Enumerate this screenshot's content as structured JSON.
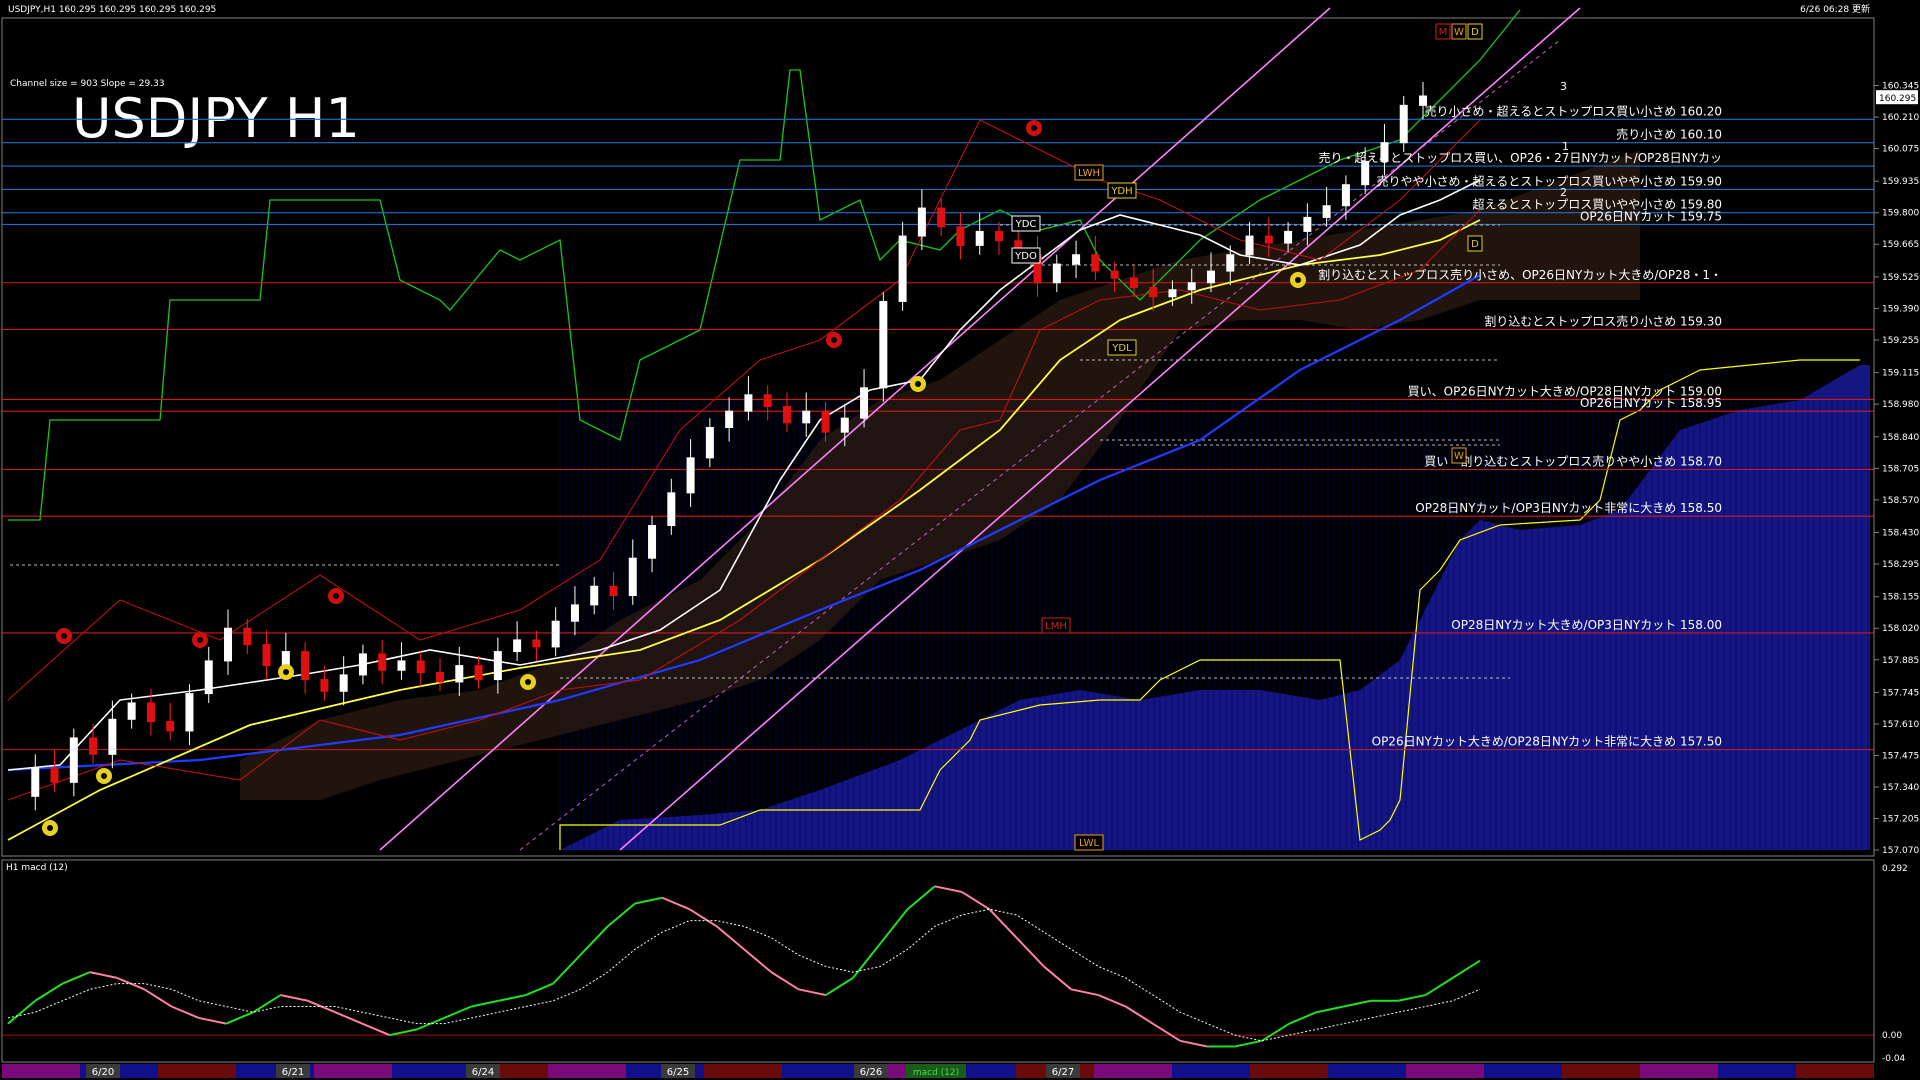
{
  "header": {
    "symbol_info": "USDJPY,H1  160.295 160.295 160.295 160.295",
    "updated": "6/26 06:28 更新",
    "channel_info": "Channel size = 903 Slope = 29.33",
    "big_title": "USDJPY H1",
    "macd_label": "H1  macd (12)"
  },
  "chart_data": {
    "type": "line",
    "title": "USDJPY H1",
    "xlabel": "",
    "ylabel": "",
    "ylim": [
      157.07,
      160.48
    ],
    "price_ticks": [
      "160.345",
      "160.210",
      "160.075",
      "159.935",
      "159.800",
      "159.665",
      "159.525",
      "159.390",
      "159.255",
      "159.115",
      "158.980",
      "158.840",
      "158.705",
      "158.570",
      "158.430",
      "158.295",
      "158.155",
      "158.020",
      "157.885",
      "157.745",
      "157.610",
      "157.475",
      "157.340",
      "157.205",
      "157.070"
    ],
    "current_price": "160.295",
    "price_path": [
      157.3,
      157.42,
      157.36,
      157.55,
      157.48,
      157.63,
      157.7,
      157.62,
      157.58,
      157.74,
      157.88,
      158.02,
      157.95,
      157.86,
      157.92,
      157.8,
      157.75,
      157.82,
      157.91,
      157.84,
      157.88,
      157.83,
      157.79,
      157.86,
      157.8,
      157.92,
      157.97,
      157.94,
      158.05,
      158.12,
      158.2,
      158.16,
      158.32,
      158.46,
      158.6,
      158.75,
      158.88,
      158.95,
      159.02,
      158.97,
      158.9,
      158.95,
      158.86,
      158.92,
      159.05,
      159.42,
      159.7,
      159.82,
      159.74,
      159.66,
      159.72,
      159.68,
      159.62,
      159.5,
      159.58,
      159.62,
      159.55,
      159.52,
      159.48,
      159.44,
      159.47,
      159.5,
      159.55,
      159.62,
      159.7,
      159.67,
      159.72,
      159.78,
      159.83,
      159.92,
      160.02,
      160.1,
      160.26,
      160.3
    ],
    "macd_ylim": [
      -0.04,
      0.292
    ],
    "macd_ticks": [
      "0.292",
      "0.00",
      "-0.04"
    ],
    "macd_main": [
      0.02,
      0.06,
      0.09,
      0.11,
      0.1,
      0.08,
      0.05,
      0.03,
      0.02,
      0.04,
      0.07,
      0.06,
      0.04,
      0.02,
      0.0,
      0.01,
      0.03,
      0.05,
      0.06,
      0.07,
      0.09,
      0.14,
      0.19,
      0.23,
      0.24,
      0.22,
      0.19,
      0.15,
      0.11,
      0.08,
      0.07,
      0.1,
      0.16,
      0.22,
      0.26,
      0.25,
      0.22,
      0.17,
      0.12,
      0.08,
      0.07,
      0.05,
      0.02,
      -0.01,
      -0.02,
      -0.02,
      -0.01,
      0.02,
      0.04,
      0.05,
      0.06,
      0.06,
      0.07,
      0.1,
      0.13
    ],
    "macd_signal": [
      0.03,
      0.04,
      0.06,
      0.08,
      0.09,
      0.09,
      0.08,
      0.06,
      0.05,
      0.04,
      0.05,
      0.05,
      0.05,
      0.04,
      0.03,
      0.02,
      0.02,
      0.03,
      0.04,
      0.05,
      0.06,
      0.08,
      0.11,
      0.15,
      0.18,
      0.2,
      0.2,
      0.19,
      0.17,
      0.14,
      0.12,
      0.11,
      0.12,
      0.15,
      0.19,
      0.21,
      0.22,
      0.21,
      0.18,
      0.15,
      0.12,
      0.1,
      0.07,
      0.04,
      0.02,
      0.0,
      -0.01,
      0.0,
      0.01,
      0.02,
      0.03,
      0.04,
      0.05,
      0.06,
      0.08
    ],
    "date_labels": [
      "6/20",
      "6/21",
      "6/24",
      "6/25",
      "6/26",
      "6/27"
    ],
    "price_levels": [
      {
        "text": "売り小さめ・超えるとストップロス買い小さめ 160.20",
        "value": 160.2,
        "color": "#1e6fd0"
      },
      {
        "text": "売り小さめ 160.10",
        "value": 160.1,
        "color": "#1e6fd0"
      },
      {
        "text": "売り・超えるとストップロス買い、OP26・27日NYカット/OP28日NYカッ",
        "value": 160.0,
        "color": "#1e6fd0"
      },
      {
        "text": "売りやや小さめ・超えるとストップロス買いやや小さめ 159.90",
        "value": 159.9,
        "color": "#1e6fd0"
      },
      {
        "text": "超えるとストップロス買いやや小さめ 159.80",
        "value": 159.8,
        "color": "#1e6fd0"
      },
      {
        "text": "OP26日NYカット 159.75",
        "value": 159.75,
        "color": "#1e6fd0"
      },
      {
        "text": "割り込むとストップロス売り小さめ、OP26日NYカット大きめ/OP28・1・",
        "value": 159.5,
        "color": "#d01a1a"
      },
      {
        "text": "割り込むとストップロス売り小さめ 159.30",
        "value": 159.3,
        "color": "#d01a1a"
      },
      {
        "text": "買い、OP26日NYカット大きめ/OP28日NYカット 159.00",
        "value": 159.0,
        "color": "#d01a1a"
      },
      {
        "text": "OP26日NYカット 158.95",
        "value": 158.95,
        "color": "#d01a1a"
      },
      {
        "text": "買い・割り込むとストップロス売りやや小さめ 158.70",
        "value": 158.7,
        "color": "#d01a1a"
      },
      {
        "text": "OP28日NYカット/OP3日NYカット非常に大きめ 158.50",
        "value": 158.5,
        "color": "#d01a1a"
      },
      {
        "text": "OP28日NYカット大きめ/OP3日NYカット 158.00",
        "value": 158.0,
        "color": "#d01a1a"
      },
      {
        "text": "OP26日NYカット大きめ/OP28日NYカット非常に大きめ 157.50",
        "value": 157.5,
        "color": "#d01a1a"
      }
    ],
    "markers": {
      "ydc": "YDC",
      "ydo": "YDO",
      "ydh": "YDH",
      "ydl": "YDL",
      "lwh": "LWH",
      "lwl": "LWL",
      "lmh": "LMH",
      "m": "M",
      "w": "W",
      "d_top": "D",
      "d_mid": "D",
      "w_small": "W",
      "ch_1": "1",
      "ch_2": "2",
      "ch_3": "3",
      "macd_box": "macd (12)"
    }
  }
}
